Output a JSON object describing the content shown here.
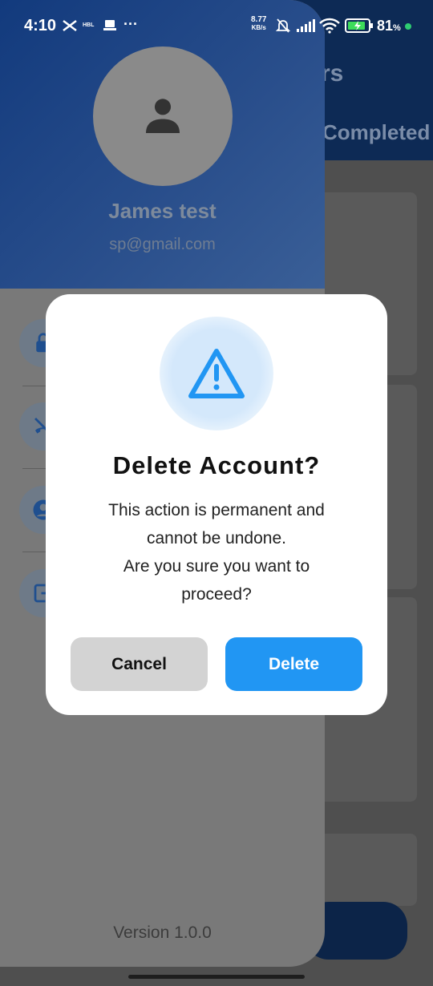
{
  "status_bar": {
    "time": "4:10",
    "net_speed_value": "8.77",
    "net_speed_unit": "KB/s",
    "battery_percent": "81",
    "battery_unit": "%",
    "notif_text": "HBL",
    "more": "···"
  },
  "background": {
    "title_fragment": "rs",
    "tab_fragment": "Completed"
  },
  "drawer": {
    "user_name": "James test",
    "user_email": "sp@gmail.com",
    "version": "Version 1.0.0",
    "menu_icons": [
      "lock-icon",
      "phone-off-icon",
      "account-circle-icon",
      "logout-icon"
    ]
  },
  "dialog": {
    "icon": "warning-icon",
    "title": "Delete Account?",
    "message_line1": "This action is permanent and",
    "message_line2": "cannot be undone.",
    "message_line3": "Are you sure you want to",
    "message_line4": "proceed?",
    "cancel_label": "Cancel",
    "delete_label": "Delete",
    "accent_color": "#2196f3"
  }
}
